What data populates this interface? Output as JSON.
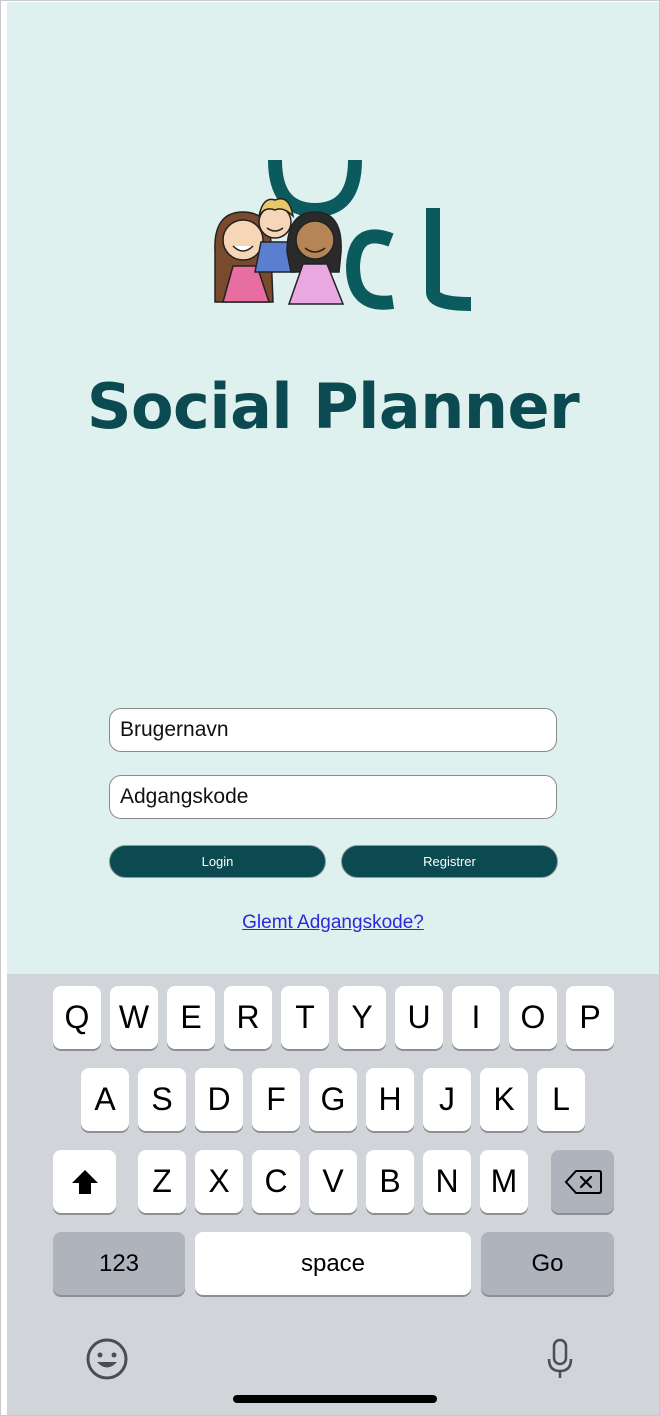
{
  "app": {
    "title": "Social Planner",
    "colors": {
      "background": "#dff1ee",
      "accent": "#0b4a50",
      "link": "#2a2ad8"
    },
    "logo": "family-kids-logo"
  },
  "login_form": {
    "username_placeholder": "Brugernavn",
    "password_placeholder": "Adgangskode",
    "login_label": "Login",
    "register_label": "Registrer",
    "forgot_label": "Glemt Adgangskode?"
  },
  "keyboard": {
    "row1": [
      "Q",
      "W",
      "E",
      "R",
      "T",
      "Y",
      "U",
      "I",
      "O",
      "P"
    ],
    "row2": [
      "A",
      "S",
      "D",
      "F",
      "G",
      "H",
      "J",
      "K",
      "L"
    ],
    "row3": [
      "Z",
      "X",
      "C",
      "V",
      "B",
      "N",
      "M"
    ],
    "shift_icon": "shift-arrow-icon",
    "backspace_icon": "backspace-icon",
    "numbers_label": "123",
    "space_label": "space",
    "go_label": "Go",
    "emoji_icon": "emoji-icon",
    "mic_icon": "microphone-icon"
  }
}
